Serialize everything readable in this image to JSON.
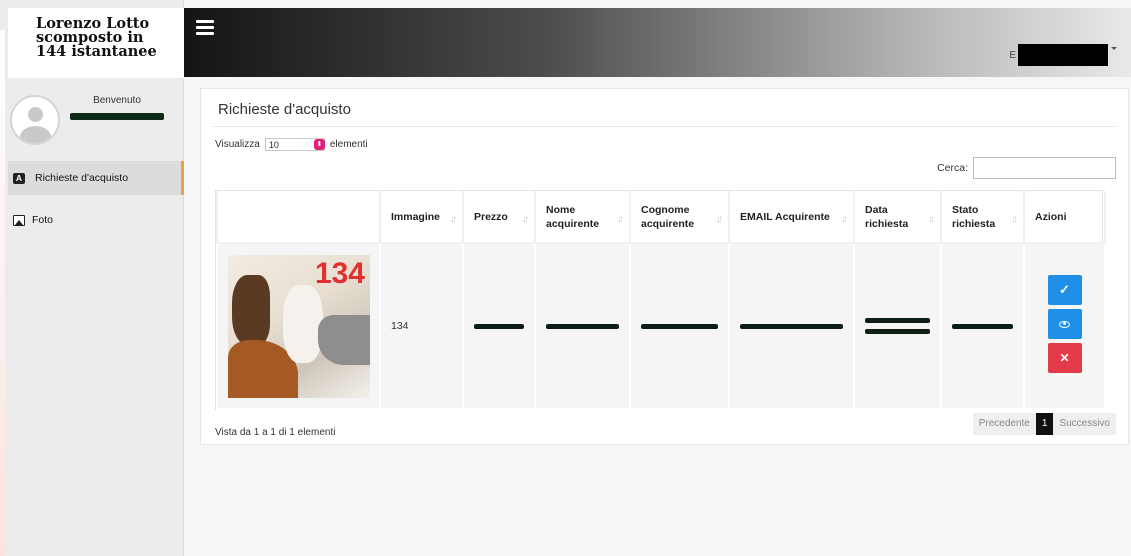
{
  "brand": {
    "line1": "Lorenzo Lotto",
    "line2": "scomposto in",
    "line3": "144 istantanee"
  },
  "user": {
    "welcome": "Benvenuto"
  },
  "sidebar": {
    "items": [
      {
        "label": "Richieste d'acquisto",
        "icon": "letter-a-icon",
        "active": true
      },
      {
        "label": "Foto",
        "icon": "photo-icon",
        "active": false
      }
    ]
  },
  "topbar": {
    "user_initial": "E"
  },
  "panel": {
    "title": "Richieste d'acquisto",
    "length": {
      "prefix": "Visualizza",
      "value": "10",
      "suffix": "elementi",
      "options": [
        "10"
      ]
    },
    "search_label": "Cerca:",
    "search_value": "",
    "table": {
      "headers": [
        "",
        "Immagine",
        "Prezzo",
        "Nome acquirente",
        "Cognome acquirente",
        "EMAIL Acquirente",
        "Data richiesta",
        "Stato richiesta",
        "Azioni"
      ],
      "rows": [
        {
          "image_label": "134",
          "immagine": "134"
        }
      ]
    },
    "info": "Vista da 1 a 1 di 1 elementi",
    "pagination": {
      "prev": "Precedente",
      "current": "1",
      "next": "Successivo"
    }
  },
  "colors": {
    "accent": "#1f8fe8",
    "danger": "#e43b4a",
    "active_marker": "#f0a23a",
    "select_arrow": "#e0207a"
  }
}
